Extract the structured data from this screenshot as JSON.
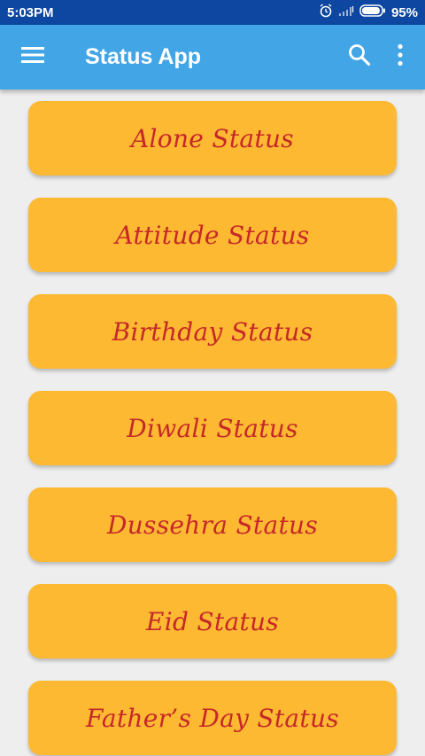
{
  "statusbar": {
    "time": "5:03PM",
    "battery_percent": "95%",
    "battery_level": 0.95,
    "icons": [
      "alarm-clock-icon",
      "signal-icon",
      "battery-icon"
    ]
  },
  "appbar": {
    "title": "Status App",
    "background_color": "#42a5e6",
    "icons": [
      "menu-icon",
      "search-icon",
      "more-vertical-icon"
    ]
  },
  "list": {
    "item_color": "#fdb932",
    "text_color": "#c62828",
    "items": [
      {
        "label": "Alone Status"
      },
      {
        "label": "Attitude Status"
      },
      {
        "label": "Birthday Status"
      },
      {
        "label": "Diwali Status"
      },
      {
        "label": "Dussehra Status"
      },
      {
        "label": "Eid Status"
      },
      {
        "label": "Father’s Day Status"
      }
    ]
  }
}
